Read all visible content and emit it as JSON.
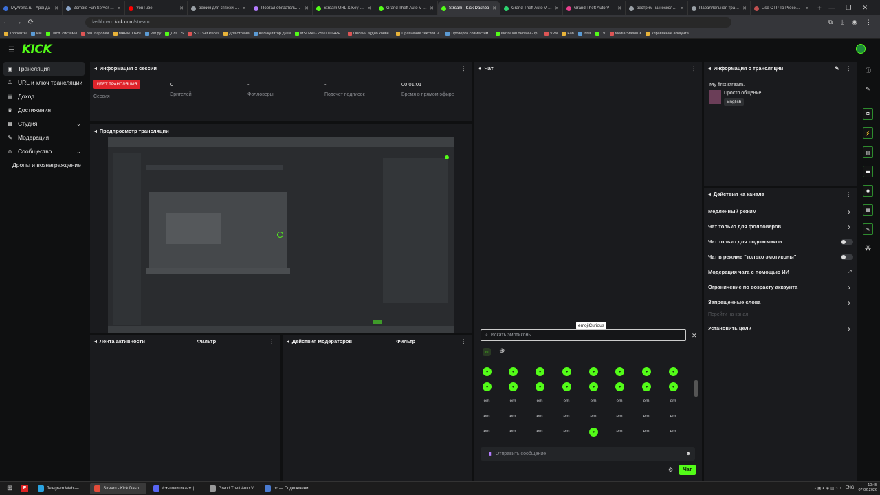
{
  "browser": {
    "tabs": [
      {
        "label": "MyArena.ru : Аренда",
        "color": "#3b6fd8"
      },
      {
        "label": "Zombie Fun Server - F",
        "color": "#8aa4c8"
      },
      {
        "label": "YouTube",
        "color": "#ff0000"
      },
      {
        "label": "режим для стяжки - П",
        "color": "#9aa0a6"
      },
      {
        "label": "Портал обязательных",
        "color": "#b47cff"
      },
      {
        "label": "Stream URL & Key - Ki",
        "color": "#53fc18"
      },
      {
        "label": "Grand Theft Auto V (G",
        "color": "#53fc18"
      },
      {
        "label": "Stream - Kick Dashbo",
        "color": "#53fc18",
        "active": true
      },
      {
        "label": "Grand Theft Auto V - T",
        "color": "#2dd36f"
      },
      {
        "label": "Grand Theft Auto V —",
        "color": "#e83e8c"
      },
      {
        "label": "рестрим на несколько",
        "color": "#9aa0a6"
      },
      {
        "label": "Параллельная трансл",
        "color": "#9aa0a6"
      },
      {
        "label": "Use OTP To Proceed - ",
        "color": "#c05050"
      }
    ],
    "url_host": "dashboard.",
    "url_domain": "kick.com",
    "url_path": "/stream",
    "bookmarks": [
      "Торренты",
      "ИИ",
      "Пасп. системы",
      "ген. паролей",
      "МАНИТОРЫ",
      "Pet.py",
      "Для CS",
      "STC Set Prices",
      "Для стрима",
      "Калькулятор дней",
      "MSI MAG Z590 TORPE...",
      "Онлайн аудио конве...",
      "Сравнение текстов н...",
      "Проверка совместим...",
      "Фотошоп онлайн - ф...",
      "VPN",
      "Fan",
      "Inter",
      "1V",
      "Media Station X",
      "Управление аккаунта..."
    ]
  },
  "kick": {
    "logo": "KICK",
    "sidebar": [
      {
        "label": "Трансляция",
        "icon": "broadcast-icon",
        "glyph": "▣",
        "active": true
      },
      {
        "label": "URL и ключ трансляции",
        "icon": "key-icon",
        "glyph": "⚿"
      },
      {
        "label": "Доход",
        "icon": "dollar-icon",
        "glyph": "▤"
      },
      {
        "label": "Достижения",
        "icon": "trophy-icon",
        "glyph": "♛"
      },
      {
        "label": "Студия",
        "icon": "studio-icon",
        "glyph": "▦",
        "chevron": true
      },
      {
        "label": "Модерация",
        "icon": "wrench-icon",
        "glyph": "✎"
      },
      {
        "label": "Сообщество",
        "icon": "community-icon",
        "glyph": "☺",
        "chevron": true
      },
      {
        "label": "Дропы и вознаграждение",
        "icon": "",
        "glyph": ""
      }
    ],
    "session": {
      "title": "Информация о сессии",
      "live_badge": "ИДЕТ ТРАНСЛЯЦИЯ",
      "session_label": "Сессия",
      "viewers_value": "0",
      "viewers_label": "Зрителей",
      "followers_value": "-",
      "followers_label": "Фолловеры",
      "subs_value": "-",
      "subs_label": "Подсчет подписок",
      "time_value": "00:01:01",
      "time_label": "Время в прямом эфире"
    },
    "preview_title": "Предпросмотр трансляции",
    "activity_title": "Лента активности",
    "mod_actions_title": "Действия модераторов",
    "filter_label": "Фильтр",
    "chat": {
      "title": "Чат",
      "tooltip": "emojiCurious",
      "search_placeholder": "Искать эмотиконы",
      "emote_text": "em",
      "message_placeholder": "Отправить сообщение",
      "send_label": "Чат"
    },
    "stream_info": {
      "title": "Информация о трансляции",
      "stream_title": "My first stream.",
      "category": "Просто общение",
      "language": "English"
    },
    "channel_actions": {
      "title": "Действия на канале",
      "items": [
        {
          "label": "Медленный режим",
          "control": "arrow"
        },
        {
          "label": "Чат только для фолловеров",
          "control": "arrow"
        },
        {
          "label": "Чат только для подписчиков",
          "control": "toggle"
        },
        {
          "label": "Чат в режиме \"только эмотиконы\"",
          "control": "toggle"
        },
        {
          "label": "Модерация чата с помощью ИИ",
          "control": "external"
        },
        {
          "label": "Ограничение по возрасту аккаунта",
          "control": "arrow"
        },
        {
          "label": "Запрещенные слова",
          "control": "arrow"
        },
        {
          "label": "Перейти на канал",
          "control": "none",
          "muted": true
        },
        {
          "label": "Установить цели",
          "control": "arrow"
        }
      ]
    }
  },
  "taskbar": {
    "apps": [
      {
        "label": "Telegram Web — ...",
        "color": "#2aa3e0"
      },
      {
        "label": "Stream - Kick Dash...",
        "color": "#e34c3a",
        "active": true
      },
      {
        "label": "#✦-политика-✦ | ...",
        "color": "#5865f2"
      },
      {
        "label": "Grand Theft Auto V",
        "color": "#999999"
      },
      {
        "label": "pc — Подключени...",
        "color": "#4a7bd0"
      }
    ],
    "lang": "ENG",
    "time": "10:45",
    "date": "07.02.2026"
  },
  "colors": {
    "accent": "#53fc18",
    "live": "#e0242b",
    "panel": "#1a1b1e"
  }
}
